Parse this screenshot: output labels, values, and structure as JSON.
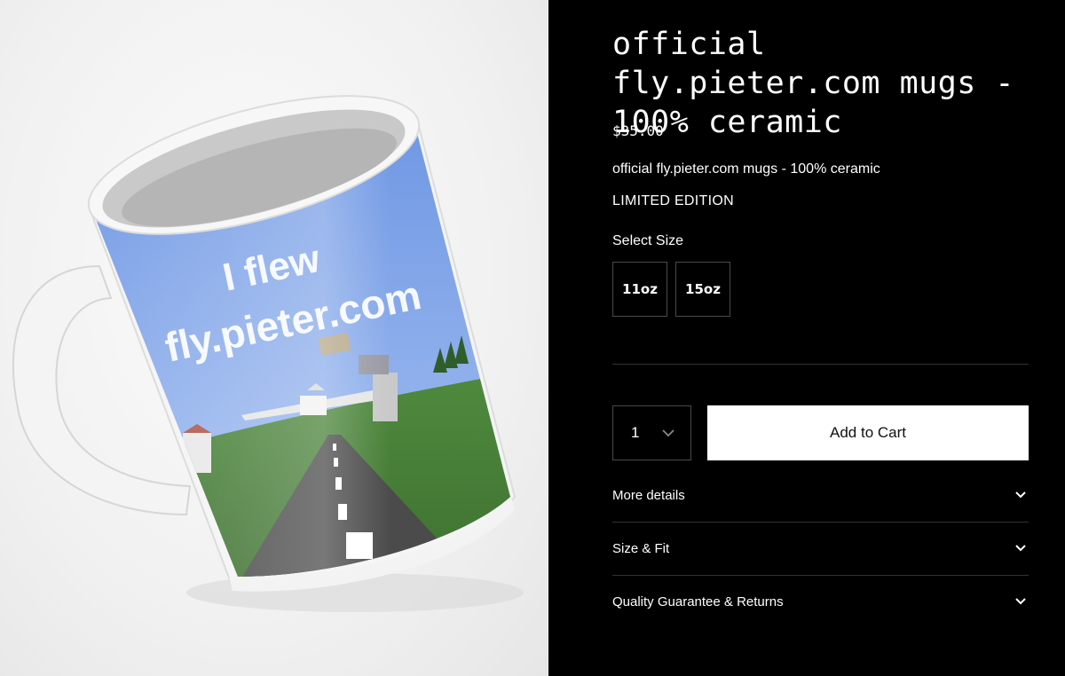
{
  "product": {
    "title": "official fly.pieter.com mugs - 100% ceramic",
    "price": "$35.00",
    "description": "official fly.pieter.com mugs - 100% ceramic",
    "edition": "LIMITED EDITION"
  },
  "mug_print": {
    "line1": "I flew",
    "line2": "fly.pieter.com"
  },
  "size_selector": {
    "label": "Select Size",
    "options": [
      "11oz",
      "15oz"
    ]
  },
  "quantity": {
    "value": "1"
  },
  "cart": {
    "add_label": "Add to Cart"
  },
  "accordion": [
    {
      "label": "More details"
    },
    {
      "label": "Size & Fit"
    },
    {
      "label": "Quality Guarantee & Returns"
    }
  ],
  "icons": {
    "quantity_dropdown": "chevron-down-icon",
    "accordion_expand": "chevron-down-icon"
  },
  "colors": {
    "background": "#000000",
    "button": "#ffffff",
    "border": "#4a4a4a",
    "mug_sky": "#7fa6ea",
    "mug_grass": "#4a7a3a"
  }
}
